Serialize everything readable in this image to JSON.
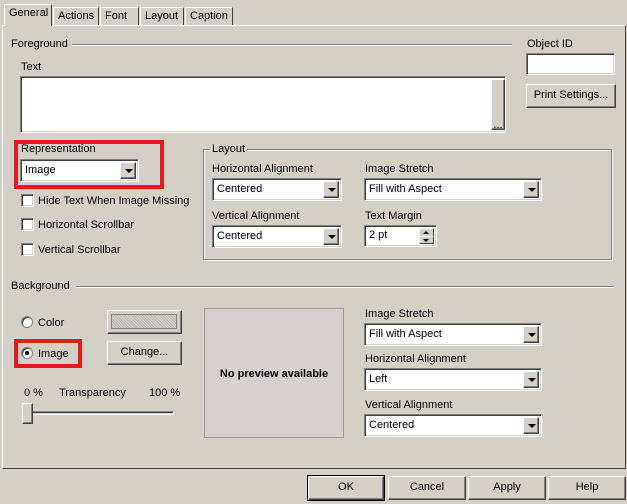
{
  "tabs": [
    {
      "label": "General",
      "active": true
    },
    {
      "label": "Actions",
      "active": false
    },
    {
      "label": "Font",
      "active": false
    },
    {
      "label": "Layout",
      "active": false
    },
    {
      "label": "Caption",
      "active": false
    }
  ],
  "foreground": {
    "section_label": "Foreground",
    "text_label": "Text",
    "text_value": "",
    "ellipsis_label": "...",
    "representation_label": "Representation",
    "representation_value": "Image",
    "hide_text_label": "Hide Text When Image Missing",
    "hide_text_checked": false,
    "hscroll_label": "Horizontal Scrollbar",
    "hscroll_checked": false,
    "vscroll_label": "Vertical Scrollbar",
    "vscroll_checked": false
  },
  "object_id": {
    "label": "Object ID",
    "value": ""
  },
  "print_settings_label": "Print Settings...",
  "layout": {
    "group_label": "Layout",
    "h_align_label": "Horizontal Alignment",
    "h_align_value": "Centered",
    "image_stretch_label": "Image Stretch",
    "image_stretch_value": "Fill with Aspect",
    "v_align_label": "Vertical Alignment",
    "v_align_value": "Centered",
    "text_margin_label": "Text Margin",
    "text_margin_value": "2 pt"
  },
  "background": {
    "section_label": "Background",
    "color_label": "Color",
    "color_selected": false,
    "image_label": "Image",
    "image_selected": true,
    "change_label": "Change...",
    "preview_text": "No preview available",
    "transparency_min": "0 %",
    "transparency_label": "Transparency",
    "transparency_max": "100 %",
    "transparency_value": 0,
    "image_stretch_label": "Image Stretch",
    "image_stretch_value": "Fill with Aspect",
    "h_align_label": "Horizontal Alignment",
    "h_align_value": "Left",
    "v_align_label": "Vertical Alignment",
    "v_align_value": "Centered"
  },
  "footer": {
    "ok_label": "OK",
    "cancel_label": "Cancel",
    "apply_label": "Apply",
    "help_label": "Help"
  },
  "colors": {
    "dialog_bg": "#d4d0c8",
    "highlight_box": "#e31b1b",
    "preview_bg": "#d6d0ce"
  }
}
